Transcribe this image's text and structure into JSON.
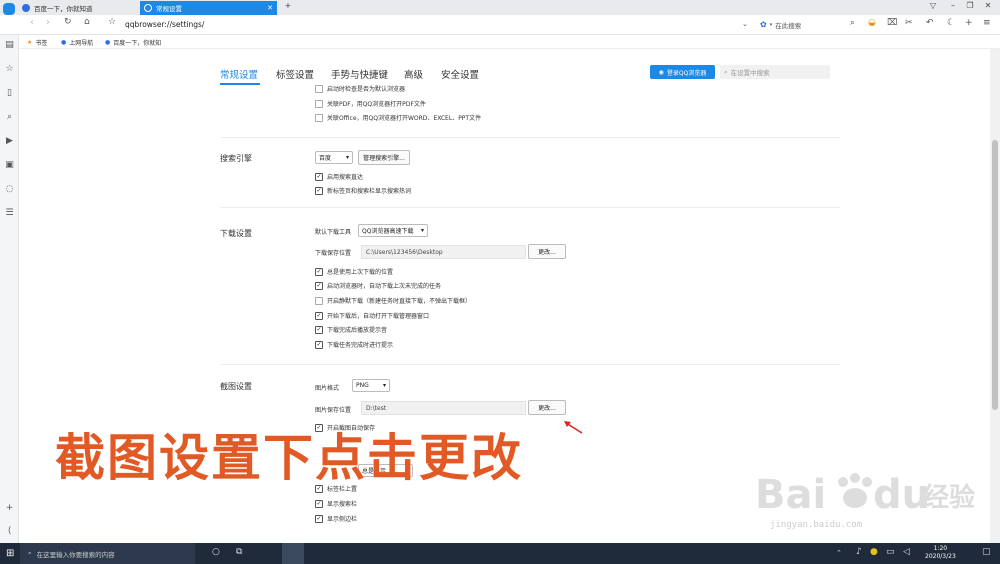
{
  "tabs": [
    {
      "title": "百度一下，你就知道"
    },
    {
      "title": "常规设置"
    }
  ],
  "address": {
    "url": "qqbrowser://settings/",
    "search_placeholder": "在此搜索"
  },
  "bookmarks": {
    "label": "书签",
    "items": [
      "上网导航",
      "百度一下，你就知"
    ]
  },
  "settings_nav": [
    "常规设置",
    "标签设置",
    "手势与快捷键",
    "高级",
    "安全设置"
  ],
  "login_button": "登录QQ浏览器",
  "settings_search_placeholder": "在设置中搜索",
  "startup": {
    "items": [
      {
        "label": "启动时检查是否为默认浏览器",
        "checked": false
      },
      {
        "label": "关联PDF，用QQ浏览器打开PDF文件",
        "checked": false
      },
      {
        "label": "关联Office，用QQ浏览器打开WORD、EXCEL、PPT文件",
        "checked": false
      }
    ]
  },
  "search_engine": {
    "title": "搜索引擎",
    "selected": "百度",
    "manage_button": "管理搜索引擎...",
    "items": [
      {
        "label": "启用搜索直达",
        "checked": true
      },
      {
        "label": "新标签页和搜索栏显示搜索热词",
        "checked": true
      }
    ]
  },
  "download": {
    "title": "下载设置",
    "tool_label": "默认下载工具",
    "tool_selected": "QQ浏览器高速下载",
    "path_label": "下载保存位置",
    "path_value": "C:\\Users\\123456\\Desktop",
    "change_button": "更改...",
    "items": [
      {
        "label": "总是使用上次下载的位置",
        "checked": true
      },
      {
        "label": "启动浏览器时，自动下载上次未完成的任务",
        "checked": true
      },
      {
        "label": "开启静默下载（新建任务时直接下载，不弹出下载框）",
        "checked": false
      },
      {
        "label": "开始下载后，自动打开下载管理器窗口",
        "checked": true
      },
      {
        "label": "下载完成后播放提示音",
        "checked": true
      },
      {
        "label": "下载任务完成时进行提示",
        "checked": true
      }
    ]
  },
  "screenshot": {
    "title": "截图设置",
    "format_label": "图片格式",
    "format_selected": "PNG",
    "path_label": "图片保存位置",
    "path_value": "D:\\test",
    "change_button": "更改...",
    "autosave_label": "开启截图自动保存",
    "autosave_checked": true
  },
  "tabbar": {
    "select_value": "总是显示",
    "items": [
      {
        "label": "标签栏上置",
        "checked": true
      },
      {
        "label": "显示搜索栏",
        "checked": true
      },
      {
        "label": "显示侧边栏",
        "checked": true
      }
    ]
  },
  "caption": "截图设置下点击更改",
  "watermark": {
    "text": "jingyan.baidu.com"
  },
  "taskbar": {
    "search_placeholder": "在这里输入你要搜索的内容",
    "time": "1:20",
    "date": "2020/3/23"
  }
}
